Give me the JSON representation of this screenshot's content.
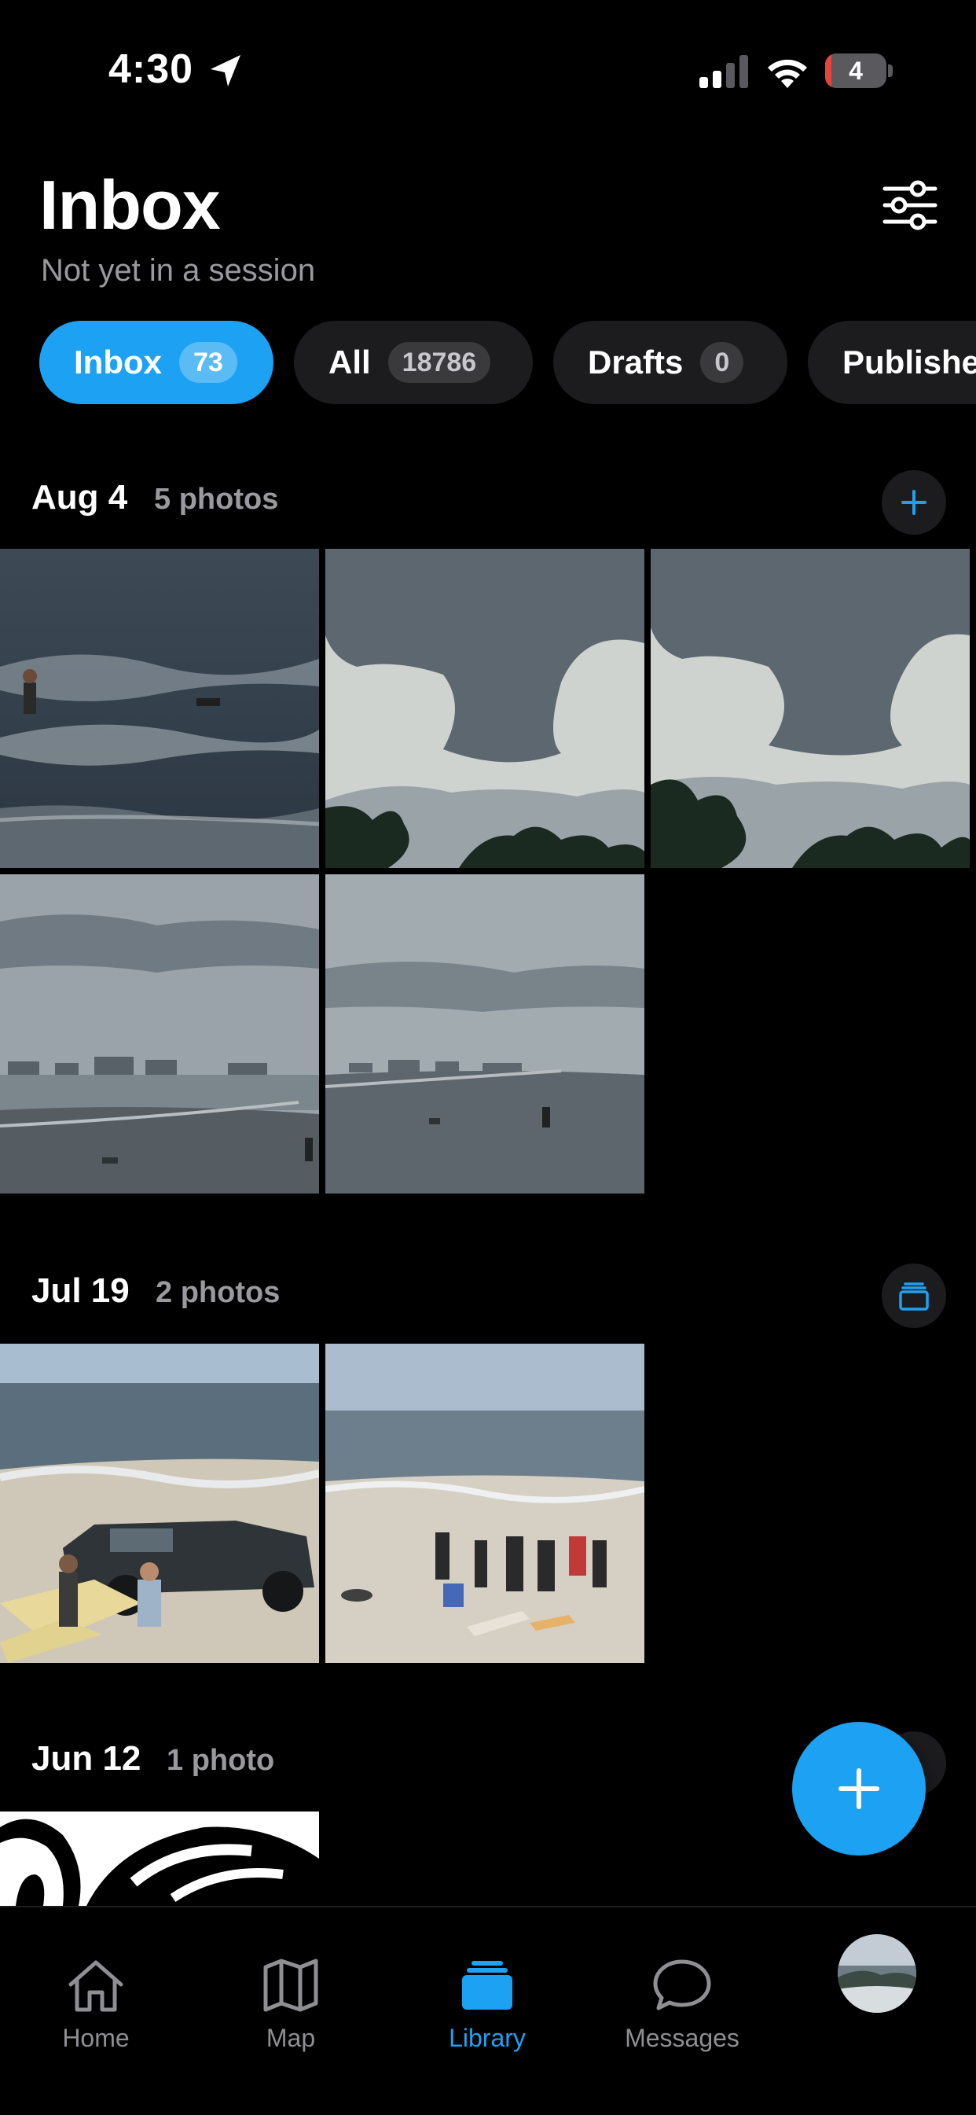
{
  "status_bar": {
    "time": "4:30",
    "battery": "4"
  },
  "header": {
    "title": "Inbox",
    "subtitle": "Not yet in a session"
  },
  "tabs": [
    {
      "label": "Inbox",
      "count": "73",
      "active": true
    },
    {
      "label": "All",
      "count": "18786"
    },
    {
      "label": "Drafts",
      "count": "0"
    },
    {
      "label": "Published"
    }
  ],
  "sections": [
    {
      "date": "Aug 4",
      "count": "5 photos"
    },
    {
      "date": "Jul 19",
      "count": "2 photos"
    },
    {
      "date": "Jun 12",
      "count": "1 photo"
    }
  ],
  "nav": [
    {
      "label": "Home",
      "icon": "house-icon"
    },
    {
      "label": "Map",
      "icon": "map-icon"
    },
    {
      "label": "Library",
      "icon": "stack-icon",
      "active": true
    },
    {
      "label": "Messages",
      "icon": "speech-bubble-icon"
    },
    {
      "label": "",
      "icon": "avatar"
    }
  ],
  "colors": {
    "accent": "#1da1f2",
    "background": "#000000",
    "chip": "#1c1c1e",
    "secondary_text": "#9a9a9e"
  }
}
